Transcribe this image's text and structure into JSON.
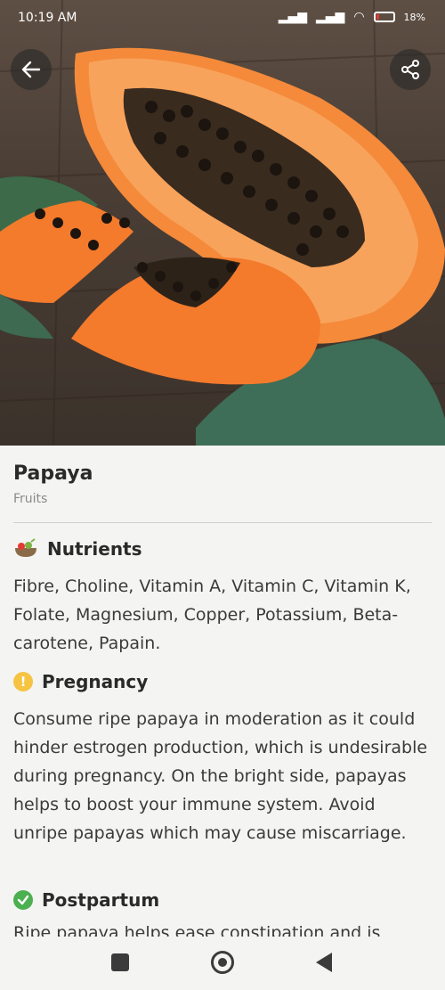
{
  "status_bar": {
    "time": "10:19 AM",
    "battery": "18%"
  },
  "hero": {
    "image_subject": "papaya-photo"
  },
  "item": {
    "title": "Papaya",
    "category": "Fruits"
  },
  "sections": [
    {
      "heading": "Nutrients",
      "icon": "salad-bowl-icon",
      "body": "Fibre, Choline, Vitamin A, Vitamin C, Vitamin K, Folate, Magnesium, Copper, Potassium, Beta-carotene, Papain."
    },
    {
      "heading": "Pregnancy",
      "icon": "warning-icon",
      "body": "Consume ripe papaya in moderation as it could hinder estrogen production, which is undesirable during pregnancy. On the bright side, papayas helps to boost your immune system. Avoid unripe papayas which may cause miscarriage."
    },
    {
      "heading": "Postpartum",
      "icon": "check-icon",
      "body": "Ripe papaya helps ease constipation and is"
    }
  ],
  "colors": {
    "warning": "#f6c342",
    "success": "#4caf50",
    "papaya_flesh": "#f47a2c"
  }
}
